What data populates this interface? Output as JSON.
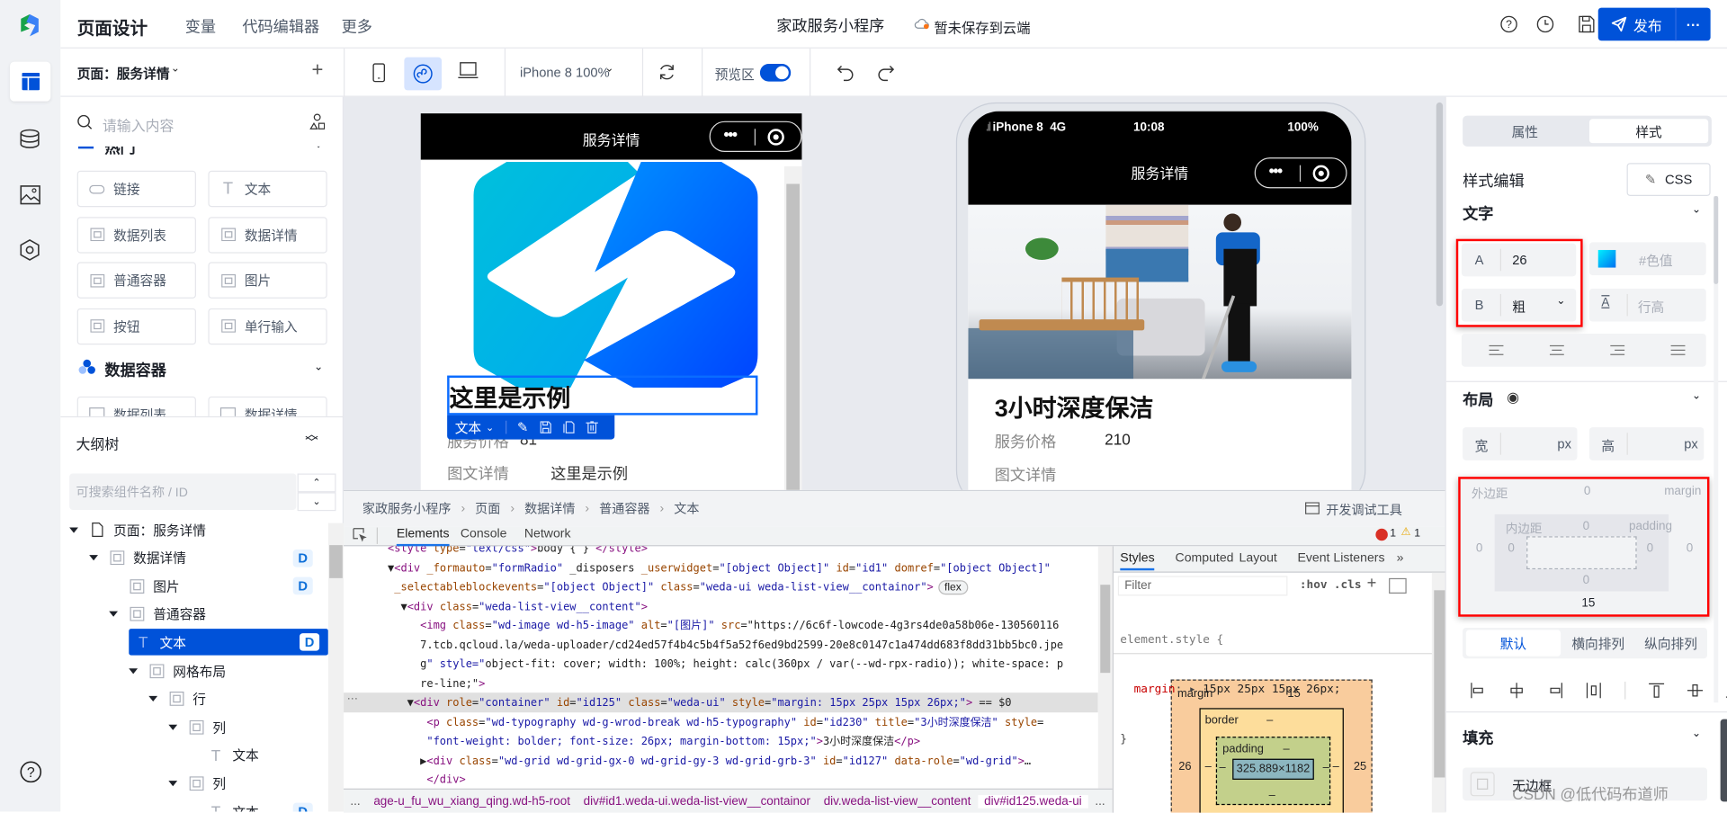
{
  "colors": {
    "brand": "#0052d9",
    "run": "#16a34a",
    "highlight": "#ff0000",
    "unsaved_dot": "#f97316"
  },
  "header": {
    "tabs": [
      "页面设计",
      "变量",
      "代码编辑器",
      "更多"
    ],
    "app_title": "家政服务小程序",
    "save_status": "暂未保存到云端",
    "publish": "发布",
    "more": "···"
  },
  "rail": {
    "icons": [
      "page-icon",
      "database-icon",
      "image-icon",
      "extension-icon",
      "help-icon"
    ]
  },
  "toolbar": {
    "page_selector": "页面：服务详情",
    "device": "iPhone 8 100%",
    "preview_label": "预览区",
    "preview_on": true
  },
  "components": {
    "search_placeholder": "请输入内容",
    "group1": "热门",
    "items": [
      "链接",
      "文本",
      "数据列表",
      "数据详情",
      "普通容器",
      "图片",
      "按钮",
      "单行输入"
    ],
    "group2": "数据容器",
    "items2": [
      "数据列表",
      "数据详情"
    ]
  },
  "outline": {
    "title": "大纲树",
    "search_placeholder": "可搜索组件名称 / ID",
    "nodes": [
      {
        "label": "页面：服务详情",
        "level": 0,
        "icon": "file-icon",
        "expanded": true,
        "badge": ""
      },
      {
        "label": "数据详情",
        "level": 1,
        "icon": "chart-icon",
        "expanded": true,
        "badge": "D"
      },
      {
        "label": "图片",
        "level": 2,
        "icon": "image-icon",
        "expanded": null,
        "badge": "D"
      },
      {
        "label": "普通容器",
        "level": 2,
        "icon": "container-icon",
        "expanded": true,
        "badge": ""
      },
      {
        "label": "文本",
        "level": 3,
        "icon": "text-icon",
        "expanded": null,
        "badge": "D",
        "selected": true
      },
      {
        "label": "网格布局",
        "level": 3,
        "icon": "grid-icon",
        "expanded": true,
        "badge": ""
      },
      {
        "label": "行",
        "level": 4,
        "icon": "container-icon",
        "expanded": true,
        "badge": ""
      },
      {
        "label": "列",
        "level": 5,
        "icon": "container-icon",
        "expanded": true,
        "badge": ""
      },
      {
        "label": "文本",
        "level": 6,
        "icon": "text-icon",
        "expanded": null,
        "badge": ""
      },
      {
        "label": "列",
        "level": 5,
        "icon": "container-icon",
        "expanded": true,
        "badge": ""
      },
      {
        "label": "文本",
        "level": 6,
        "icon": "text-icon",
        "expanded": null,
        "badge": "D"
      }
    ]
  },
  "editor_phone": {
    "nav_title": "服务详情",
    "selected_text": "这里是示例",
    "toolbar_label": "文本",
    "price_label": "服务价格",
    "price_value": "81",
    "detail_label": "图文详情",
    "detail_value": "这里是示例"
  },
  "preview_phone": {
    "carrier": "iPhone 8",
    "network": "4G",
    "time": "10:08",
    "battery": "100%",
    "nav_title": "服务详情",
    "title": "3小时深度保洁",
    "price_label": "服务价格",
    "price_value": "210",
    "detail_label": "图文详情"
  },
  "devtools": {
    "breadcrumb": [
      "家政服务小程序",
      "页面",
      "数据详情",
      "普通容器",
      "文本"
    ],
    "open_label": "开发调试工具",
    "tabs": [
      "Elements",
      "Console",
      "Network"
    ],
    "errors": "1",
    "warnings": "1",
    "code_lines": [
      "<style type=\"text/css\">body { } </style>",
      "▼<div _formauto=\"formRadio\" _disposers _userwidget=\"[object Object]\" id=\"id1\" domref=\"[object Object]\"",
      " _selectableblockevents=\"[object Object]\" class=\"weda-ui weda-list-view__containor\">",
      "  ▼<div class=\"weda-list-view__content\">",
      "     <img class=\"wd-image wd-h5-image\" alt=\"[图片]\" src=\"https://6c6f-lowcode-4g3rs4de0a58b06e-130560116",
      "     7.tcb.qcloud.la/weda-uploader/cd24ed57f4b4c5b4f5a52f6ed9bd2599-20e8c0147c1a474dd683f8dd31bb5bc0.jpe",
      "     g\" style=\"object-fit: cover; width: 100%; height: calc(360px / var(--wd-rpx-radio)); white-space: p",
      "     re-line;\">",
      "   ▼<div role=\"container\" id=\"id125\" class=\"weda-ui\" style=\"margin: 15px 25px 15px 26px;\"> == $0",
      "      <p class=\"wd-typography wd-g-wrod-break wd-h5-typography\" id=\"id230\" title=\"3小时深度保洁\" style=",
      "      \"font-weight: bolder; font-size: 26px; margin-bottom: 15px;\">3小时深度保洁</p>",
      "     ▶<div class=\"wd-grid wd-grid-gx-0 wd-grid-gy-3 wd-grid-grb-3\" id=\"id127\" data-role=\"wd-grid\">…",
      "      </div>",
      "   </div>"
    ],
    "flex_badge": "flex",
    "selected_line": 8,
    "crumbs": [
      "...",
      "age-u_fu_wu_xiang_qing.wd-h5-root",
      "div#id1.weda-ui.weda-list-view__containor",
      "div.weda-list-view__content",
      "div#id125.weda-ui",
      "..."
    ],
    "style_tabs": [
      "Styles",
      "Computed",
      "Layout",
      "Event Listeners",
      "»"
    ],
    "filter_placeholder": "Filter",
    "hov": ":hov",
    "cls": ".cls",
    "element_style": "element.style {",
    "margin_prop": "margin",
    "margin_val": "15px 25px 15px 26px;",
    "close_brace": "}",
    "boxmodel": {
      "margin_label": "margin",
      "margin_top": "15",
      "margin_left": "26",
      "margin_right": "25",
      "border_label": "border",
      "dash": "–",
      "padding_label": "padding",
      "content": "325.889×1182"
    }
  },
  "props": {
    "tabs": [
      "属性",
      "样式"
    ],
    "active_tab": "样式",
    "style_edit": "样式编辑",
    "css_btn": "CSS",
    "text_section": "文字",
    "font_size_label": "A",
    "font_size": "26",
    "weight_label": "B",
    "weight": "粗",
    "color_placeholder": "#色值",
    "line_height_placeholder": "行高",
    "layout_section": "布局",
    "width_label": "宽",
    "height_label": "高",
    "unit": "px",
    "margin_label": "外边距",
    "margin_en": "margin",
    "padding_label": "内边距",
    "padding_en": "padding",
    "margin": {
      "top": "0",
      "left": "0",
      "right": "0",
      "bottom": "15"
    },
    "padding": {
      "top": "0",
      "left": "0",
      "right": "0",
      "bottom": "0"
    },
    "arrange": [
      "默认",
      "横向排列",
      "纵向排列"
    ],
    "arrange_active": "默认",
    "fill_section": "填充",
    "border_option": "无边框"
  },
  "watermark": "CSDN @低代码布道师"
}
